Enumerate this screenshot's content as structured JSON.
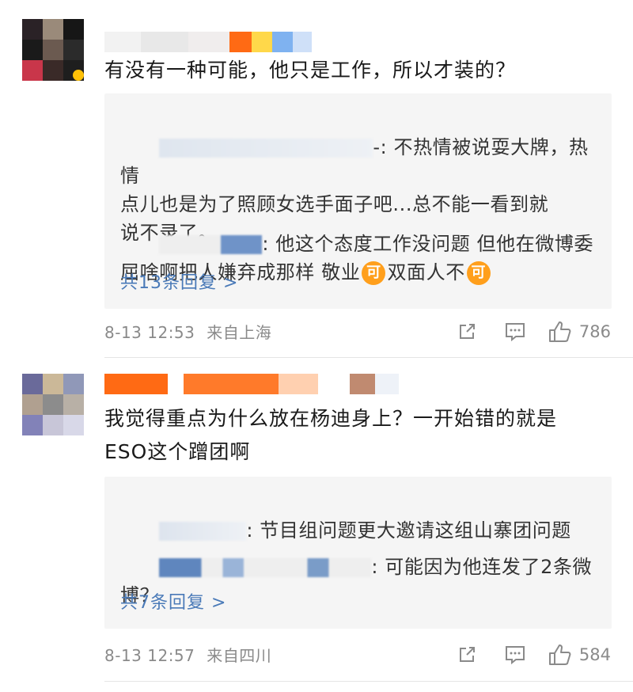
{
  "comments": [
    {
      "text": "有没有一种可能，他只是工作，所以才装的？",
      "replies": [
        {
          "tail": "-: 不热情被说耍大牌，热情\n点儿也是为了照顾女选手面子吧...总不能一看到就\n说不录了。"
        },
        {
          "tail": ": 他这个态度工作没问题 但他在微博委\n屈啥啊把人嫌弃成那样 敬业",
          "mid": "双面人不"
        }
      ],
      "emoji_label": "可",
      "more": "共13条回复 >",
      "time": "8-13 12:53",
      "source": "来自上海",
      "likes": "786"
    },
    {
      "text": "我觉得重点为什么放在杨迪身上？一开始错的就是\nESO这个蹭团啊",
      "replies": [
        {
          "tail": ": 节目组问题更大邀请这组山寨团问题"
        },
        {
          "tail": ": 可能因为他连发了2条微\n博？"
        }
      ],
      "more": "共7条回复 >",
      "time": "8-13 12:57",
      "source": "来自四川",
      "likes": "584"
    }
  ],
  "icons": [
    "share-icon",
    "comment-icon",
    "like-icon"
  ],
  "colors": {
    "link": "#4a7ab8",
    "meta": "#8a8a8a",
    "reply_bg": "#f5f5f5",
    "emoji": "#ff9f1c"
  }
}
